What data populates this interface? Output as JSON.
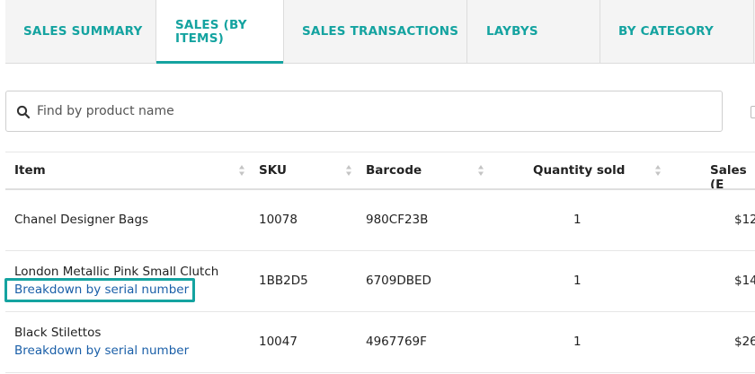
{
  "tabs": [
    {
      "label": "SALES SUMMARY"
    },
    {
      "label_line1": "SALES (BY",
      "label_line2": "ITEMS)"
    },
    {
      "label": "SALES TRANSACTIONS"
    },
    {
      "label": "LAYBYS"
    },
    {
      "label": "BY CATEGORY"
    }
  ],
  "search": {
    "placeholder": "Find by product name",
    "value": ""
  },
  "table": {
    "headers": [
      "Item",
      "SKU",
      "Barcode",
      "Quantity sold",
      "Sales (E"
    ],
    "rows": [
      {
        "item": "Chanel Designer Bags",
        "link": "",
        "sku": "10078",
        "barcode": "980CF23B",
        "qty": "1",
        "sales": "$12"
      },
      {
        "item": "London Metallic Pink Small Clutch",
        "link": "Breakdown by serial number",
        "sku": "1BB2D5",
        "barcode": "6709DBED",
        "qty": "1",
        "sales": "$14"
      },
      {
        "item": "Black Stilettos",
        "link": "Breakdown by serial number",
        "sku": "10047",
        "barcode": "4967769F",
        "qty": "1",
        "sales": "$26"
      }
    ]
  },
  "colors": {
    "accent": "#14a3a0",
    "link": "#1a5fa8"
  }
}
